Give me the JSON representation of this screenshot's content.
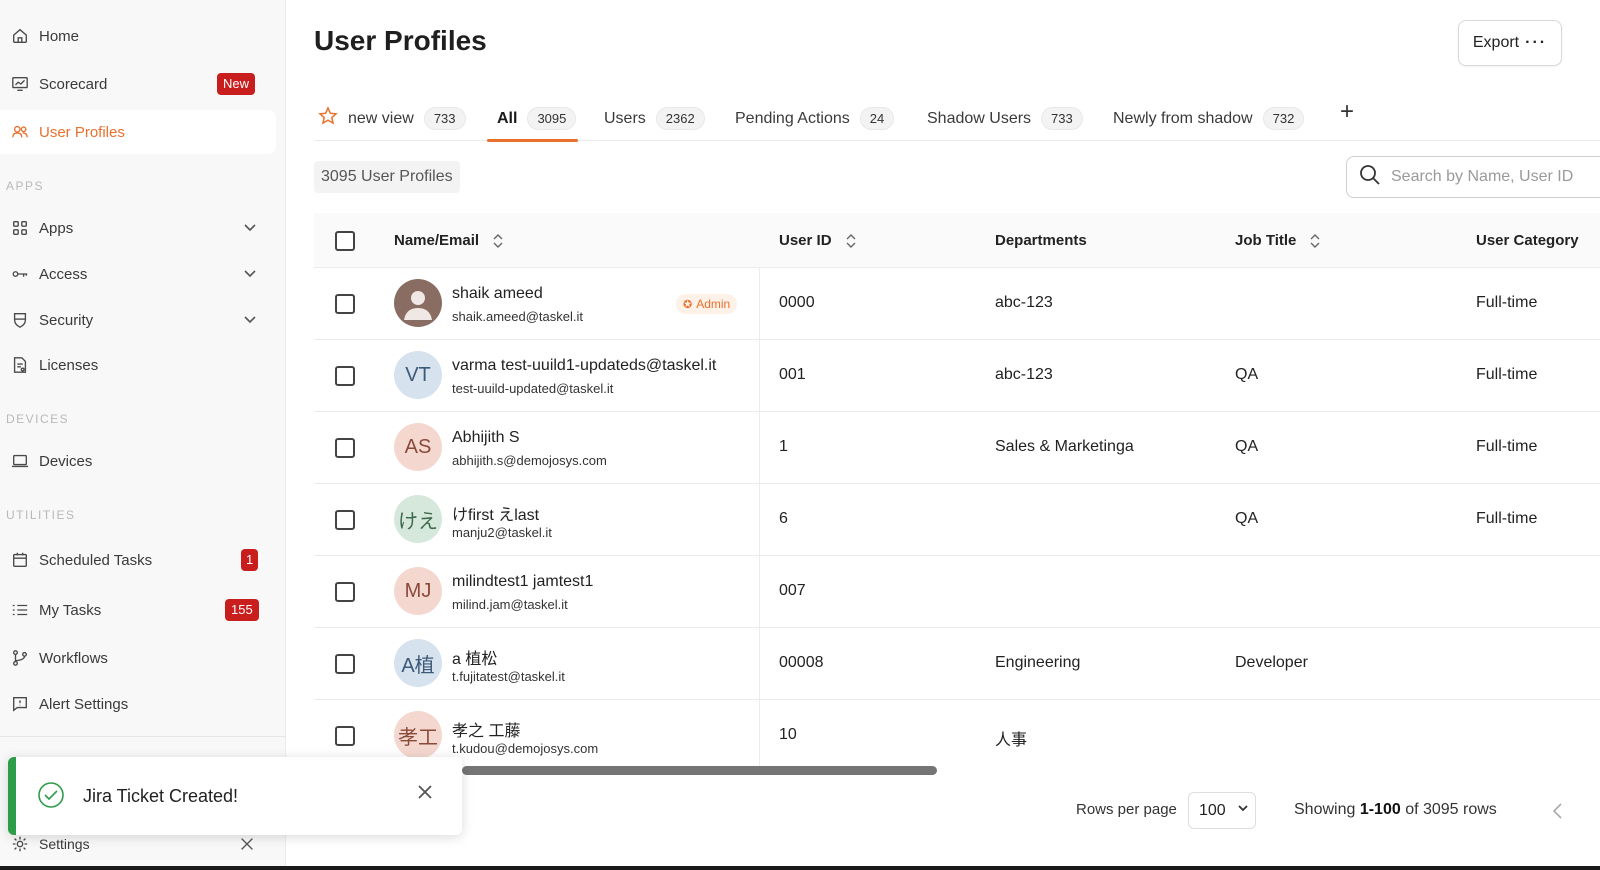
{
  "sidebar": {
    "top_items": [
      {
        "label": "Home",
        "icon": "home-icon"
      },
      {
        "label": "Scorecard",
        "icon": "scorecard-icon",
        "badge": "New"
      },
      {
        "label": "User Profiles",
        "icon": "users-icon",
        "active": true
      }
    ],
    "sections": {
      "apps": "APPS",
      "devices": "DEVICES",
      "utilities": "UTILITIES"
    },
    "apps_items": [
      {
        "label": "Apps"
      },
      {
        "label": "Access"
      },
      {
        "label": "Security"
      },
      {
        "label": "Licenses"
      }
    ],
    "devices_items": [
      {
        "label": "Devices"
      }
    ],
    "utilities_items": [
      {
        "label": "Scheduled Tasks",
        "badge": "1"
      },
      {
        "label": "My Tasks",
        "badge": "155"
      },
      {
        "label": "Workflows"
      },
      {
        "label": "Alert Settings"
      }
    ],
    "settings_label": "Settings"
  },
  "header": {
    "title": "User Profiles",
    "export_label": "Export"
  },
  "tabs": [
    {
      "label": "new view",
      "count": "733"
    },
    {
      "label": "All",
      "count": "3095",
      "active": true
    },
    {
      "label": "Users",
      "count": "2362"
    },
    {
      "label": "Pending Actions",
      "count": "24"
    },
    {
      "label": "Shadow Users",
      "count": "733"
    },
    {
      "label": "Newly from shadow",
      "count": "732"
    }
  ],
  "toolbar": {
    "profiles_count": "3095 User Profiles",
    "search_placeholder": "Search by Name, User ID"
  },
  "table": {
    "columns": {
      "name": "Name/Email",
      "user_id": "User ID",
      "departments": "Departments",
      "job_title": "Job Title",
      "category": "User Category"
    },
    "rows": [
      {
        "name": "shaik ameed",
        "email": "shaik.ameed@taskel.it",
        "initials": "",
        "admin": "Admin",
        "user_id": "0000",
        "department": "abc-123",
        "job_title": "",
        "category": "Full-time"
      },
      {
        "name": "varma test-uuild1-updateds@taskel.it",
        "email": "test-uuild-updated@taskel.it",
        "initials": "VT",
        "user_id": "001",
        "department": "abc-123",
        "job_title": "QA",
        "category": "Full-time"
      },
      {
        "name": "Abhijith S",
        "email": "abhijith.s@demojosys.com",
        "initials": "AS",
        "user_id": "1",
        "department": "Sales & Marketinga",
        "job_title": "QA",
        "category": "Full-time"
      },
      {
        "name": "けfirst えlast",
        "email": "manju2@taskel.it",
        "initials": "けえ",
        "user_id": "6",
        "department": "",
        "job_title": "QA",
        "category": "Full-time"
      },
      {
        "name": "milindtest1 jamtest1",
        "email": "milind.jam@taskel.it",
        "initials": "MJ",
        "user_id": "007",
        "department": "",
        "job_title": "",
        "category": ""
      },
      {
        "name": "a 植松",
        "email": "t.fujitatest@taskel.it",
        "initials": "A植",
        "user_id": "00008",
        "department": "Engineering",
        "job_title": "Developer",
        "category": ""
      },
      {
        "name": "孝之 工藤",
        "email": "t.kudou@demojosys.com",
        "initials": "孝工",
        "user_id": "10",
        "department": "人事",
        "job_title": "",
        "category": ""
      }
    ]
  },
  "footer": {
    "rows_per_page_label": "Rows per page",
    "rows_per_page_value": "100",
    "showing_prefix": "Showing ",
    "showing_range": "1-100",
    "showing_suffix": " of 3095 rows"
  },
  "toast": {
    "message": "Jira Ticket Created!"
  },
  "colors": {
    "accent": "#e8712d",
    "badge_red": "#c81e1e",
    "toast_green": "#2e9d4a"
  }
}
